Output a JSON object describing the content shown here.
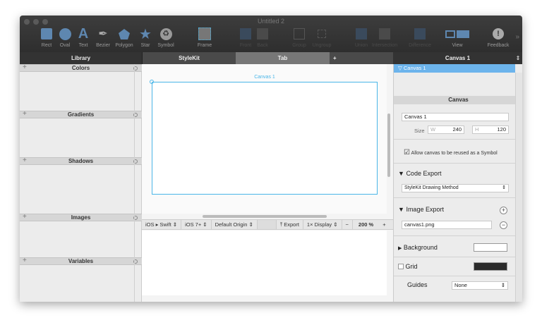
{
  "window": {
    "title": "Untitled 2"
  },
  "toolbar": {
    "items": [
      {
        "label": "Rect",
        "icon": "rect-icon"
      },
      {
        "label": "Oval",
        "icon": "oval-icon"
      },
      {
        "label": "Text",
        "icon": "text-icon"
      },
      {
        "label": "Bezier",
        "icon": "bezier-pen-icon"
      },
      {
        "label": "Polygon",
        "icon": "polygon-icon"
      },
      {
        "label": "Star",
        "icon": "star-icon"
      },
      {
        "label": "Symbol",
        "icon": "symbol-icon"
      },
      {
        "label": "Frame",
        "icon": "frame-icon"
      },
      {
        "label": "Front",
        "icon": "bring-front-icon"
      },
      {
        "label": "Back",
        "icon": "send-back-icon"
      },
      {
        "label": "Group",
        "icon": "group-icon"
      },
      {
        "label": "Ungroup",
        "icon": "ungroup-icon"
      },
      {
        "label": "Union",
        "icon": "union-icon"
      },
      {
        "label": "Intersection",
        "icon": "intersection-icon"
      },
      {
        "label": "Difference",
        "icon": "difference-icon"
      },
      {
        "label": "View",
        "icon": "view-icon"
      },
      {
        "label": "Feedback",
        "icon": "feedback-icon"
      }
    ],
    "overflow": "»"
  },
  "tabs": {
    "library": "Library",
    "stylekit": "StyleKit",
    "tab": "Tab",
    "add": "+",
    "inspector": "Canvas 1",
    "inspector_arrows": "⇕"
  },
  "library": {
    "sections": [
      "Colors",
      "Gradients",
      "Shadows",
      "Images",
      "Variables"
    ],
    "plus": "+"
  },
  "canvas": {
    "name": "Canvas 1"
  },
  "bottombar": {
    "language": "iOS ▸ Swift",
    "target": "iOS 7+",
    "origin": "Default Origin",
    "export": "Export",
    "display": "1× Display",
    "minus": "−",
    "zoom": "200 %",
    "plus": "+"
  },
  "inspector": {
    "list_item": "▽ Canvas 1",
    "header": "Canvas",
    "name_value": "Canvas 1",
    "size_label": "Size",
    "w_label": "W",
    "w_value": "240",
    "h_label": "H",
    "h_value": "120",
    "allow_symbol": "Allow canvas to be reused as a Symbol",
    "allow_symbol_checked": true,
    "code_export": "Code Export",
    "code_method": "StyleKit Drawing Method",
    "image_export": "Image Export",
    "image_file": "canvas1.png",
    "background": "Background",
    "grid": "Grid",
    "grid_checked": false,
    "guides": "Guides",
    "guides_value": "None",
    "background_color": "#ffffff",
    "grid_color": "#2b2b2b"
  },
  "colors": {
    "accent": "#4ab6e8",
    "tool": "#5e87b0"
  }
}
